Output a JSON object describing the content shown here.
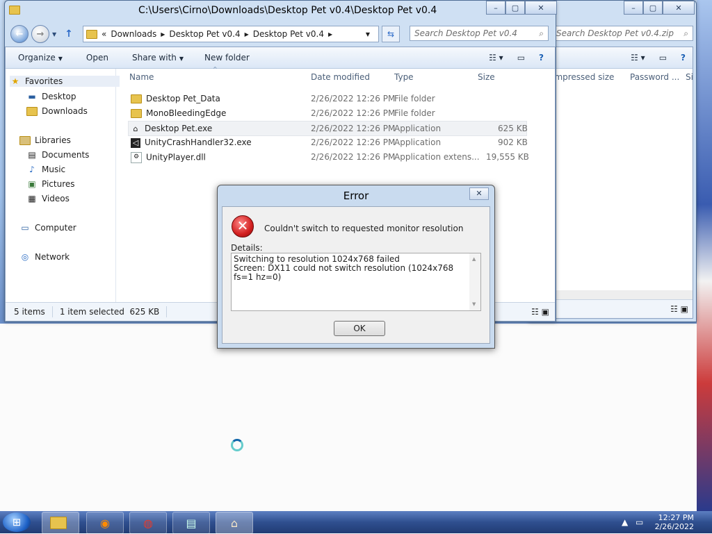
{
  "explorer": {
    "title": "C:\\Users\\Cirno\\Downloads\\Desktop Pet v0.4\\Desktop Pet v0.4",
    "caption_buttons": {
      "minimize": "–",
      "maximize": "▢",
      "close": "✕"
    },
    "address": {
      "chevron": "«",
      "crumbs": [
        "Downloads",
        "Desktop Pet v0.4",
        "Desktop Pet v0.4"
      ]
    },
    "search_placeholder": "Search Desktop Pet v0.4",
    "toolbar": {
      "organize": "Organize",
      "open": "Open",
      "share_with": "Share with",
      "new_folder": "New folder"
    },
    "nav": {
      "favorites": "Favorites",
      "favorites_items": [
        "Desktop",
        "Downloads"
      ],
      "libraries": "Libraries",
      "libraries_items": [
        "Documents",
        "Music",
        "Pictures",
        "Videos"
      ],
      "computer": "Computer",
      "network": "Network"
    },
    "columns": {
      "name": "Name",
      "date": "Date modified",
      "type": "Type",
      "size": "Size"
    },
    "files": [
      {
        "name": "Desktop Pet_Data",
        "date": "2/26/2022 12:26 PM",
        "type": "File folder",
        "size": ""
      },
      {
        "name": "MonoBleedingEdge",
        "date": "2/26/2022 12:26 PM",
        "type": "File folder",
        "size": ""
      },
      {
        "name": "Desktop Pet.exe",
        "date": "2/26/2022 12:26 PM",
        "type": "Application",
        "size": "625 KB"
      },
      {
        "name": "UnityCrashHandler32.exe",
        "date": "2/26/2022 12:26 PM",
        "type": "Application",
        "size": "902 KB"
      },
      {
        "name": "UnityPlayer.dll",
        "date": "2/26/2022 12:26 PM",
        "type": "Application extens...",
        "size": "19,555 KB"
      }
    ],
    "status": {
      "items": "5 items",
      "selected": "1 item selected  625 KB"
    }
  },
  "zip_window": {
    "search_placeholder": "Search Desktop Pet v0.4.zip",
    "columns": {
      "compressed": "...mpressed size",
      "password": "Password ...",
      "size": "Si"
    }
  },
  "dialog": {
    "title": "Error",
    "close": "✕",
    "message": "Couldn't switch to requested monitor resolution",
    "details_label": "Details:",
    "details_line1": "Switching to resolution 1024x768 failed",
    "details_line2": "Screen: DX11 could not switch resolution (1024x768 fs=1 hz=0)",
    "ok": "OK"
  },
  "taskbar": {
    "time": "12:27 PM",
    "date": "2/26/2022"
  }
}
